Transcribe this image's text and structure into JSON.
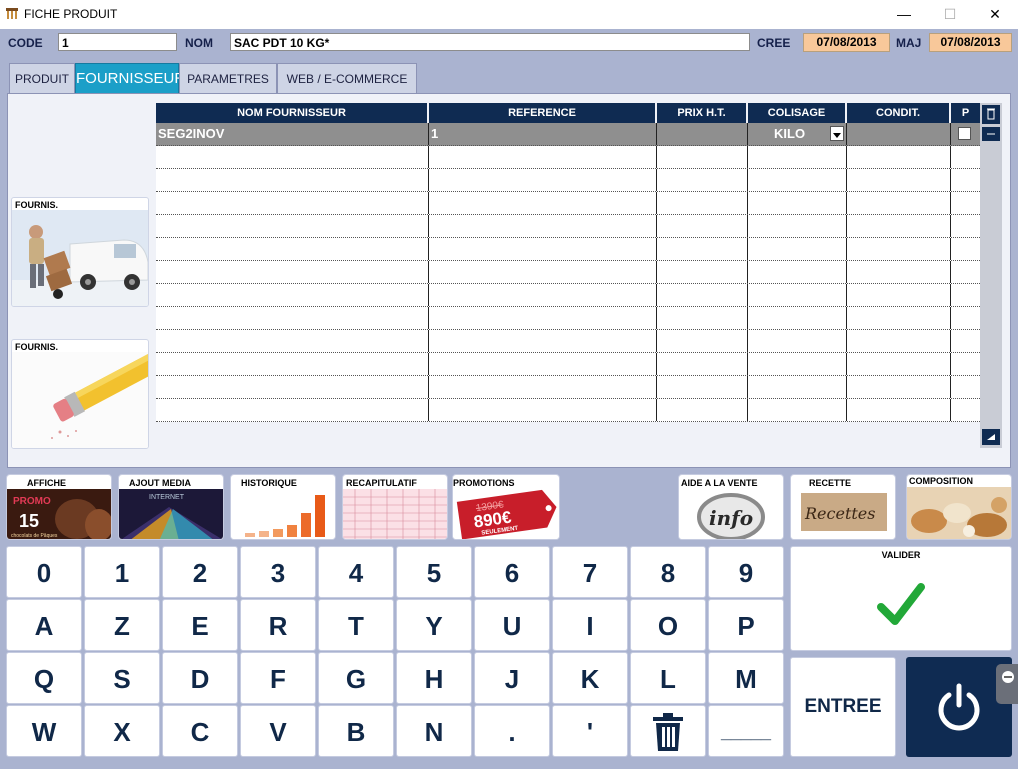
{
  "window": {
    "title": "FICHE PRODUIT",
    "minimize": "—",
    "maximize": "☐",
    "close": "✕"
  },
  "header": {
    "code_label": "CODE",
    "code_value": "1",
    "nom_label": "NOM",
    "nom_value": "SAC PDT 10 KG*",
    "cree_label": "CREE",
    "cree_value": "07/08/2013",
    "maj_label": "MAJ",
    "maj_value": "07/08/2013"
  },
  "tabs": [
    "PRODUIT",
    "FOURNISSEUR",
    "PARAMETRES",
    "WEB / E-COMMERCE"
  ],
  "active_tab": "FOURNISSEUR",
  "side_cards": [
    {
      "label": "FOURNIS.",
      "icon": "delivery-man-van-image"
    },
    {
      "label": "FOURNIS.",
      "icon": "pencil-eraser-image"
    }
  ],
  "grid": {
    "columns": [
      "NOM FOURNISSEUR",
      "REFERENCE",
      "PRIX H.T.",
      "COLISAGE",
      "CONDIT.",
      "P"
    ],
    "rows": [
      [
        "SEG2INOV",
        "1",
        "",
        "KILO",
        "",
        ""
      ],
      [
        "",
        "",
        "",
        "",
        "",
        ""
      ],
      [
        "",
        "",
        "",
        "",
        "",
        ""
      ],
      [
        "",
        "",
        "",
        "",
        "",
        ""
      ],
      [
        "",
        "",
        "",
        "",
        "",
        ""
      ],
      [
        "",
        "",
        "",
        "",
        "",
        ""
      ],
      [
        "",
        "",
        "",
        "",
        "",
        ""
      ],
      [
        "",
        "",
        "",
        "",
        "",
        ""
      ],
      [
        "",
        "",
        "",
        "",
        "",
        ""
      ],
      [
        "",
        "",
        "",
        "",
        "",
        ""
      ],
      [
        "",
        "",
        "",
        "",
        "",
        ""
      ],
      [
        "",
        "",
        "",
        "",
        "",
        ""
      ],
      [
        "",
        "",
        "",
        "",
        "",
        ""
      ]
    ]
  },
  "media_tiles": [
    {
      "label": "AFFICHE",
      "promo_text": "PROMO",
      "promo_pct": "15",
      "promo_sub": "chocolats de Pâques"
    },
    {
      "label": "AJOUT MEDIA",
      "media_text": "INTERNET"
    },
    {
      "label": "HISTORIQUE"
    },
    {
      "label": "RECAPITULATIF"
    },
    {
      "label": "PROMOTIONS",
      "old_price": "1390€",
      "new_price": "890€",
      "seulement": "SEULEMENT"
    },
    {
      "label": "AIDE A LA VENTE",
      "info_text": "info"
    },
    {
      "label": "RECETTE",
      "recettes_text": "Recettes"
    },
    {
      "label": "COMPOSITION"
    }
  ],
  "keypad": {
    "row1": [
      "0",
      "1",
      "2",
      "3",
      "4",
      "5",
      "6",
      "7",
      "8",
      "9"
    ],
    "row2": [
      "A",
      "Z",
      "E",
      "R",
      "T",
      "Y",
      "U",
      "I",
      "O",
      "P"
    ],
    "row3": [
      "Q",
      "S",
      "D",
      "F",
      "G",
      "H",
      "J",
      "K",
      "L",
      "M"
    ],
    "row4": [
      "W",
      "X",
      "C",
      "V",
      "B",
      "N",
      ".",
      "'",
      "trash-icon",
      "_____"
    ]
  },
  "valider_label": "VALIDER",
  "entree_label": "ENTREE",
  "colors": {
    "background": "#aab3d0",
    "grid_header": "#0f2b52",
    "active_tab": "#1b9fc8",
    "date_field": "#f8c89a",
    "check_green": "#22a838",
    "power_button": "#0f2b52"
  }
}
